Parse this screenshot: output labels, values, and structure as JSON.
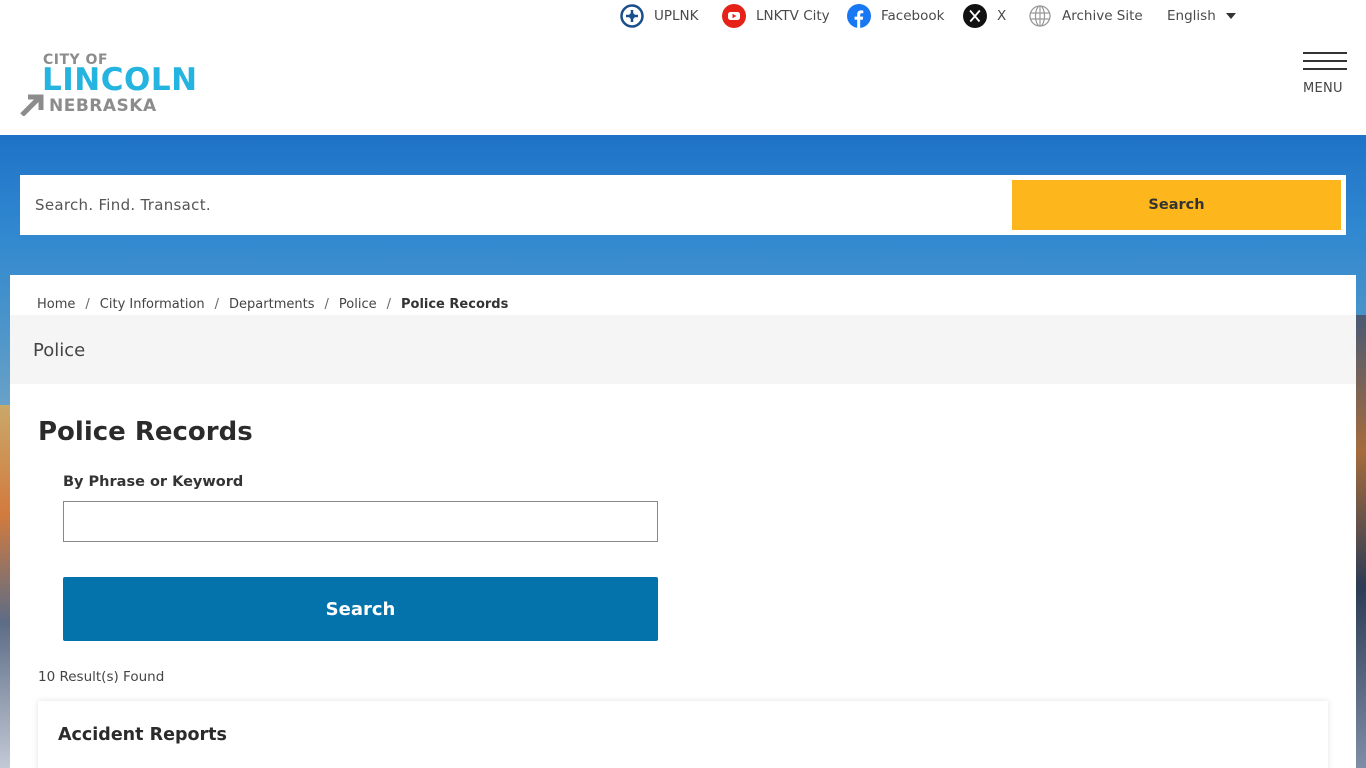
{
  "utility_links": [
    {
      "label": "UPLNK",
      "icon": "uplnk-icon"
    },
    {
      "label": "LNKTV City",
      "icon": "youtube-icon"
    },
    {
      "label": "Facebook",
      "icon": "facebook-icon"
    },
    {
      "label": "X",
      "icon": "x-icon"
    },
    {
      "label": "Archive Site",
      "icon": "globe-icon"
    }
  ],
  "language": {
    "selected": "English"
  },
  "logo": {
    "city_of": "CITY OF",
    "lincoln": "LINCOLN",
    "nebraska": "NEBRASKA"
  },
  "menu": {
    "label": "MENU"
  },
  "site_search": {
    "placeholder": "Search. Find. Transact.",
    "button": "Search"
  },
  "breadcrumb": [
    {
      "label": "Home"
    },
    {
      "label": "City Information"
    },
    {
      "label": "Departments"
    },
    {
      "label": "Police"
    },
    {
      "label": "Police Records"
    }
  ],
  "breadcrumb_separator": "/",
  "section": {
    "title": "Police"
  },
  "main": {
    "title": "Police Records",
    "field_label": "By Phrase or Keyword",
    "keyword_value": "",
    "search_button": "Search",
    "results_count": "10 Result(s) Found",
    "results": [
      {
        "title": "Accident Reports"
      }
    ]
  },
  "colors": {
    "brand_blue": "#25b3e0",
    "search_yellow": "#fdb61b",
    "primary_button": "#0573ab",
    "youtube_red": "#e62117",
    "facebook_blue": "#1877f2"
  }
}
